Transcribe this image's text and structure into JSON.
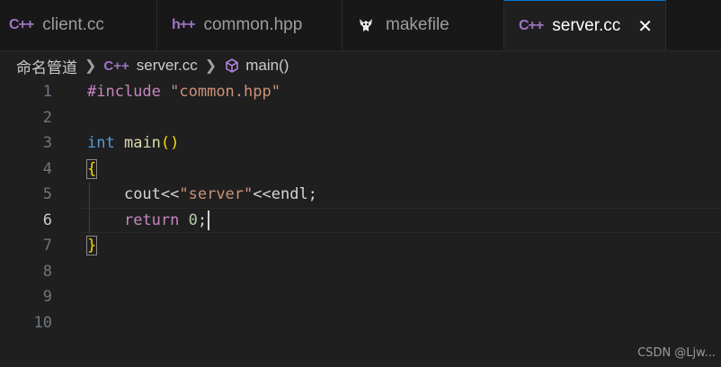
{
  "tabs": [
    {
      "icon": "C++",
      "label": "client.cc"
    },
    {
      "icon": "h++",
      "label": "common.hpp"
    },
    {
      "icon": "gnu-icon",
      "label": "makefile"
    },
    {
      "icon": "C++",
      "label": "server.cc",
      "close": "✕"
    }
  ],
  "breadcrumb": {
    "folder": "命名管道",
    "file": "server.cc",
    "file_icon": "C++",
    "symbol": "main()"
  },
  "editor": {
    "line_numbers": [
      "1",
      "2",
      "3",
      "4",
      "5",
      "6",
      "7",
      "8",
      "9",
      "10"
    ],
    "current_line": "6",
    "code": {
      "l1_directive": "#include",
      "l1_string": "\"common.hpp\"",
      "l3_type": "int",
      "l3_func": "main",
      "l3_parens": "()",
      "l4_brace": "{",
      "l5_a": "cout<<",
      "l5_string": "\"server\"",
      "l5_b": "<<endl;",
      "l6_kw": "return",
      "l6_num": "0",
      "l6_semi": ";",
      "l7_brace": "}"
    }
  },
  "watermark": "CSDN @Ljw..."
}
